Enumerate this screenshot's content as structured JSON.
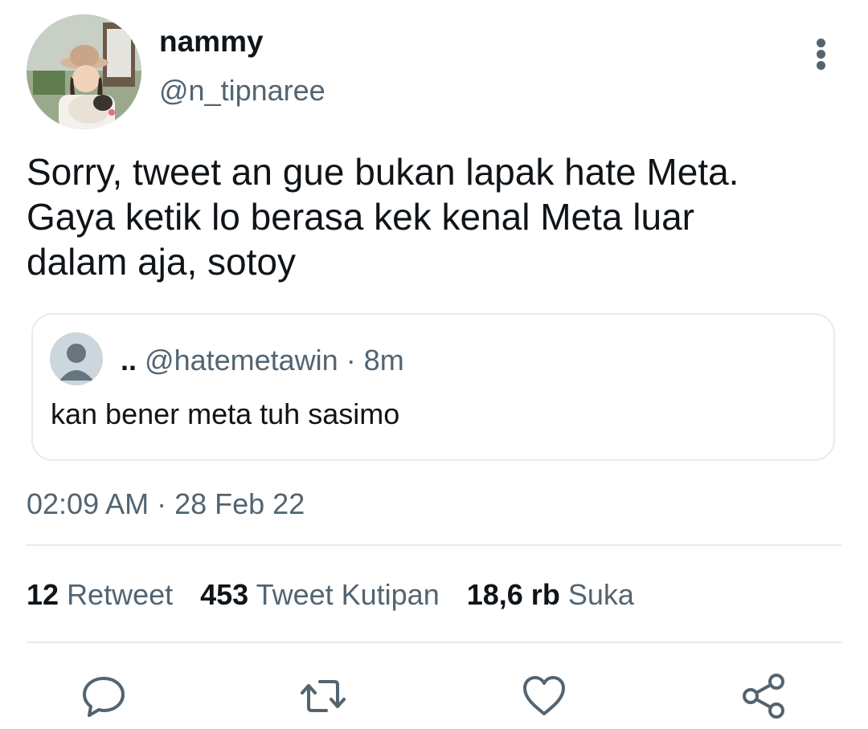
{
  "author": {
    "display_name": "nammy",
    "handle": "@n_tipnaree"
  },
  "tweet": {
    "text_lines": [
      "Sorry, tweet an gue bukan lapak hate Meta.",
      "Gaya ketik lo berasa kek kenal Meta luar",
      "dalam aja, sotoy"
    ],
    "timestamp": "02:09 AM · 28 Feb 22"
  },
  "quote": {
    "name": "..",
    "handle_time": "@hatemetawin · 8m",
    "text": "kan bener meta tuh sasimo"
  },
  "stats": {
    "retweets_count": "12",
    "retweets_label": "Retweet",
    "quotes_count": "453",
    "quotes_label": "Tweet Kutipan",
    "likes_count": "18,6 rb",
    "likes_label": "Suka"
  },
  "icons": {
    "more": "more-vertical-icon",
    "reply": "reply-icon",
    "retweet": "retweet-icon",
    "like": "heart-icon",
    "share": "share-icon"
  },
  "colors": {
    "text_primary": "#0f1419",
    "text_secondary": "#536471",
    "divider": "#e6ecf0"
  }
}
